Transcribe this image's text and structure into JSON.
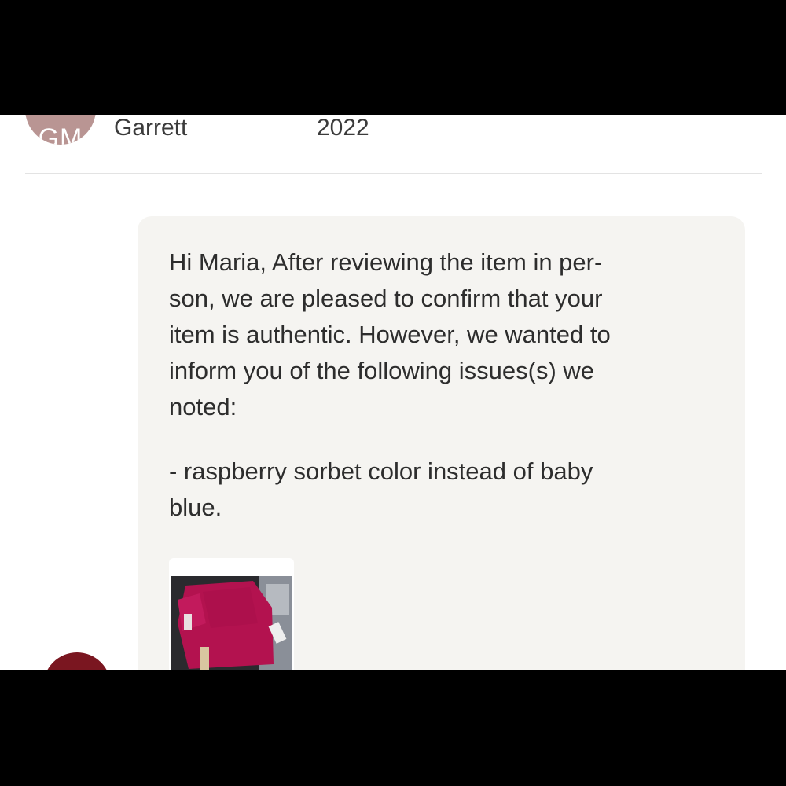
{
  "header": {
    "avatar_initials": "GM",
    "sender_name": "Garrett",
    "date": "2022"
  },
  "message": {
    "body": "Hi Maria, After reviewing the item in per-\nson, we are pleased to confirm that your\nitem is authentic. However, we wanted to\ninform you of the following issues(s) we\nnoted:",
    "issue": "- raspberry sorbet color instead of baby\nblue.",
    "attachment_icon": "garment-photo-thumbnail"
  },
  "next_message": {
    "avatar_color": "#7a1620"
  },
  "colors": {
    "avatar_top": "#b99593",
    "bubble_bg": "#f5f4f1",
    "text": "#2d2d2d",
    "garment": "#b3124f"
  }
}
